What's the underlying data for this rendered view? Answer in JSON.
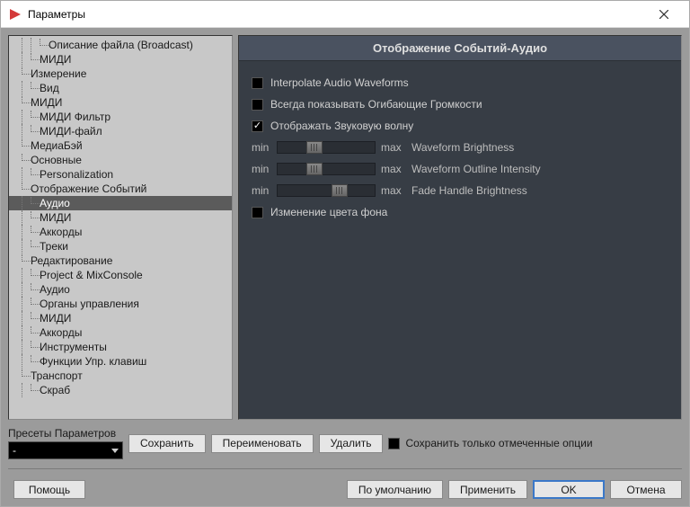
{
  "window": {
    "title": "Параметры"
  },
  "tree": [
    {
      "label": "Описание файла (Broadcast)",
      "depth": 3
    },
    {
      "label": "МИДИ",
      "depth": 2
    },
    {
      "label": "Измерение",
      "depth": 1
    },
    {
      "label": "Вид",
      "depth": 2
    },
    {
      "label": "МИДИ",
      "depth": 1
    },
    {
      "label": "МИДИ Фильтр",
      "depth": 2
    },
    {
      "label": "МИДИ-файл",
      "depth": 2
    },
    {
      "label": "МедиаБэй",
      "depth": 1
    },
    {
      "label": "Основные",
      "depth": 1
    },
    {
      "label": "Personalization",
      "depth": 2
    },
    {
      "label": "Отображение Событий",
      "depth": 1
    },
    {
      "label": "Аудио",
      "depth": 2,
      "selected": true
    },
    {
      "label": "МИДИ",
      "depth": 2
    },
    {
      "label": "Аккорды",
      "depth": 2
    },
    {
      "label": "Треки",
      "depth": 2
    },
    {
      "label": "Редактирование",
      "depth": 1
    },
    {
      "label": "Project & MixConsole",
      "depth": 2
    },
    {
      "label": "Аудио",
      "depth": 2
    },
    {
      "label": "Органы управления",
      "depth": 2
    },
    {
      "label": "МИДИ",
      "depth": 2
    },
    {
      "label": "Аккорды",
      "depth": 2
    },
    {
      "label": "Инструменты",
      "depth": 2
    },
    {
      "label": "Функции Упр. клавиш",
      "depth": 2
    },
    {
      "label": "Транспорт",
      "depth": 1
    },
    {
      "label": "Скраб",
      "depth": 2
    }
  ],
  "detail": {
    "title": "Отображение Событий-Аудио",
    "options": [
      {
        "label": "Interpolate Audio Waveforms",
        "checked": false
      },
      {
        "label": "Всегда показывать Огибающие Громкости",
        "checked": false
      },
      {
        "label": "Отображать Звуковую волну",
        "checked": true
      }
    ],
    "sliders": [
      {
        "min": "min",
        "max": "max",
        "label": "Waveform Brightness",
        "pos": 32
      },
      {
        "min": "min",
        "max": "max",
        "label": "Waveform Outline Intensity",
        "pos": 32
      },
      {
        "min": "min",
        "max": "max",
        "label": "Fade Handle Brightness",
        "pos": 60
      }
    ],
    "bg_option": {
      "label": "Изменение цвета фона",
      "checked": false
    }
  },
  "presets": {
    "label": "Пресеты Параметров",
    "value": "-",
    "save": "Сохранить",
    "rename": "Переименовать",
    "delete": "Удалить",
    "save_marked": "Сохранить только отмеченные опции",
    "save_marked_checked": false
  },
  "footer": {
    "help": "Помощь",
    "defaults": "По умолчанию",
    "apply": "Применить",
    "ok": "OK",
    "cancel": "Отмена"
  }
}
